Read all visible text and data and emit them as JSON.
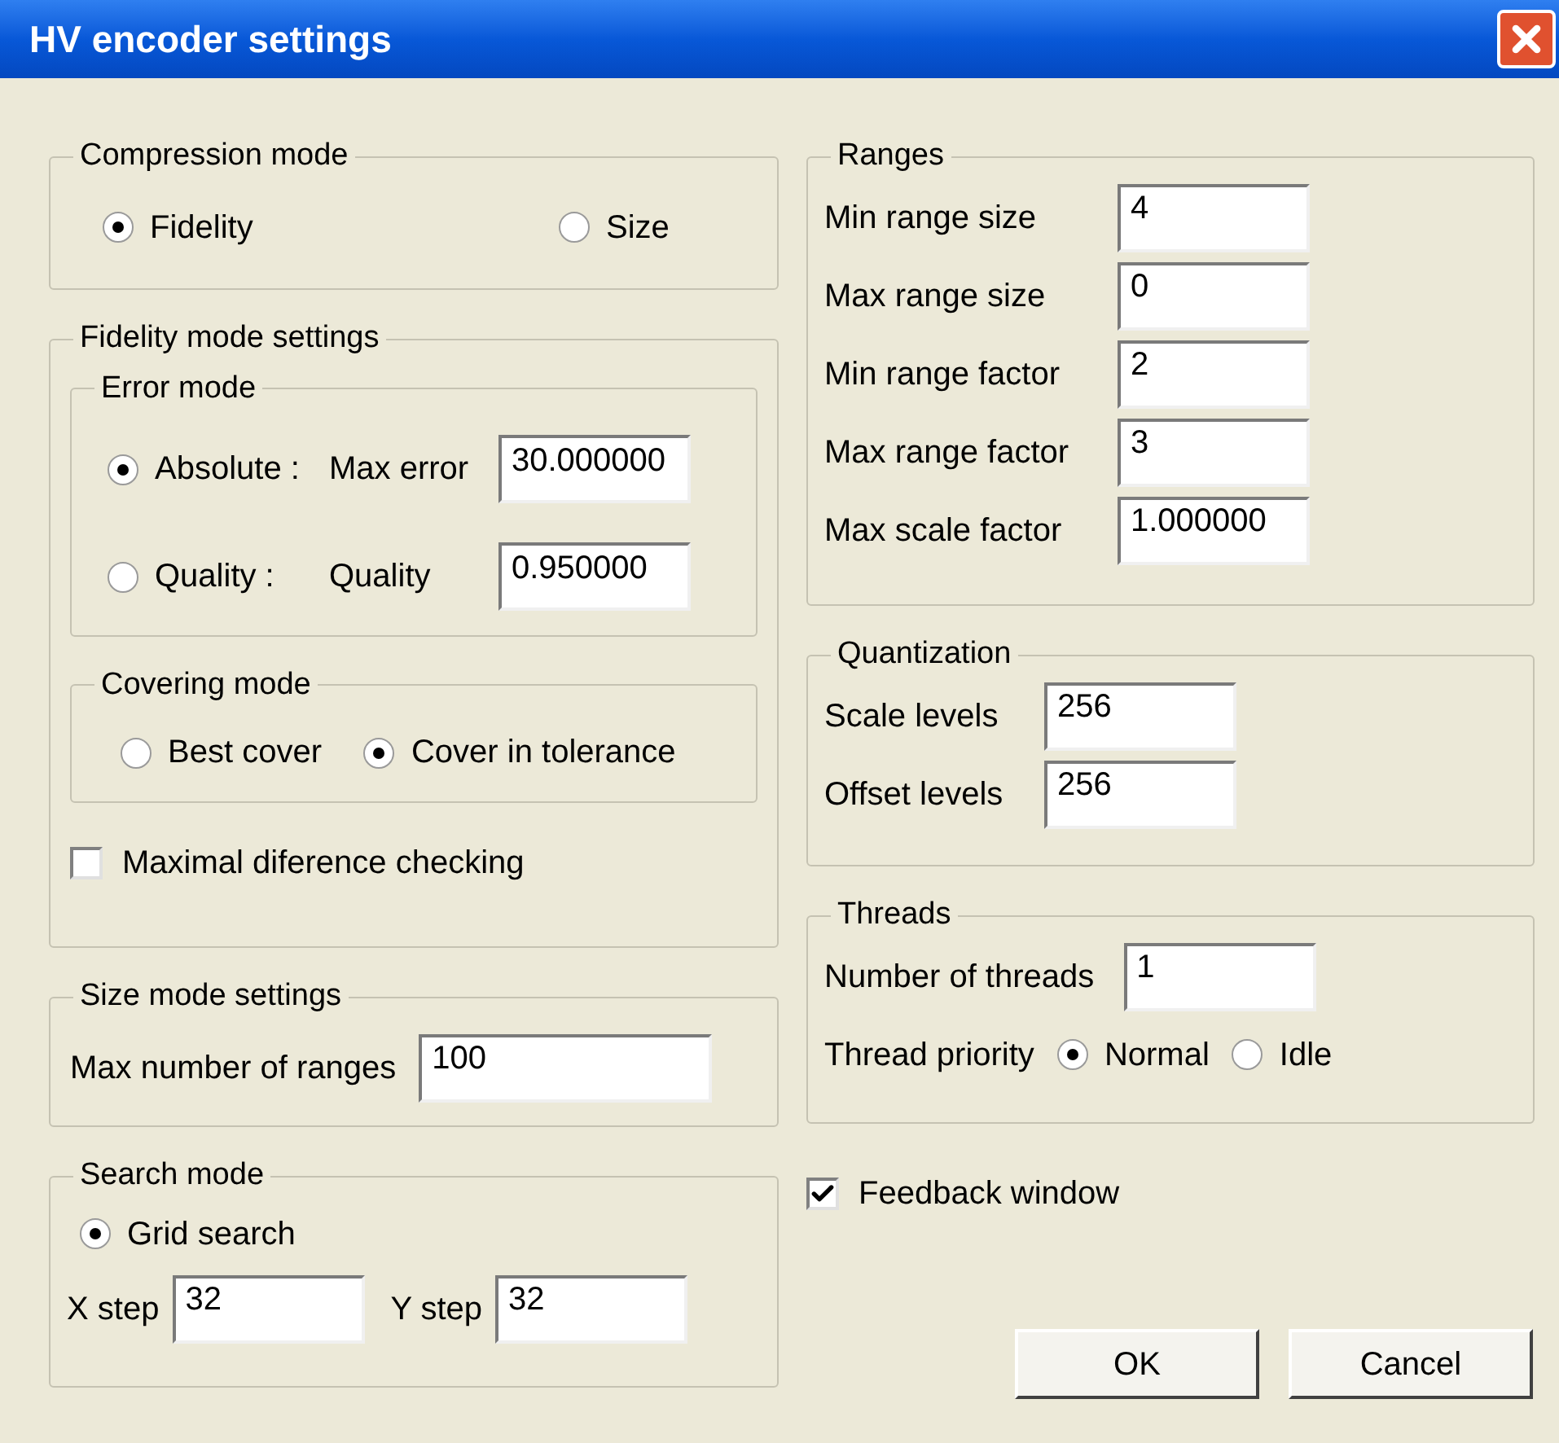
{
  "window": {
    "title": "HV encoder settings"
  },
  "compression_mode": {
    "title": "Compression mode",
    "options": [
      {
        "label": "Fidelity",
        "selected": true
      },
      {
        "label": "Size",
        "selected": false
      }
    ]
  },
  "fidelity_mode_settings": {
    "title": "Fidelity mode settings",
    "error_mode": {
      "title": "Error mode",
      "rows": [
        {
          "option": "Absolute :",
          "selected": true,
          "field_label": "Max error",
          "value": "30.000000"
        },
        {
          "option": "Quality :",
          "selected": false,
          "field_label": "Quality",
          "value": "0.950000"
        }
      ]
    },
    "covering_mode": {
      "title": "Covering mode",
      "options": [
        {
          "label": "Best cover",
          "selected": false
        },
        {
          "label": "Cover in tolerance",
          "selected": true
        }
      ]
    },
    "maximal_difference_checking": {
      "label": "Maximal diference checking",
      "checked": false
    }
  },
  "size_mode_settings": {
    "title": "Size mode settings",
    "label": "Max number of ranges",
    "value": "100"
  },
  "search_mode": {
    "title": "Search mode",
    "option": {
      "label": "Grid search",
      "selected": true
    },
    "fields": [
      {
        "label": "X step",
        "value": "32"
      },
      {
        "label": "Y step",
        "value": "32"
      }
    ]
  },
  "ranges": {
    "title": "Ranges",
    "fields": [
      {
        "label": "Min range size",
        "value": "4"
      },
      {
        "label": "Max range size",
        "value": "0"
      },
      {
        "label": "Min range factor",
        "value": "2"
      },
      {
        "label": "Max range factor",
        "value": "3"
      },
      {
        "label": "Max scale factor",
        "value": "1.000000"
      }
    ]
  },
  "quantization": {
    "title": "Quantization",
    "fields": [
      {
        "label": "Scale levels",
        "value": "256"
      },
      {
        "label": "Offset levels",
        "value": "256"
      }
    ]
  },
  "threads": {
    "title": "Threads",
    "fields": [
      {
        "label": "Number of threads",
        "value": "1"
      }
    ],
    "priority": {
      "label": "Thread priority",
      "options": [
        {
          "label": "Normal",
          "selected": true
        },
        {
          "label": "Idle",
          "selected": false
        }
      ]
    }
  },
  "feedback_window": {
    "label": "Feedback window",
    "checked": true
  },
  "buttons": [
    {
      "label": "OK"
    },
    {
      "label": "Cancel"
    }
  ]
}
